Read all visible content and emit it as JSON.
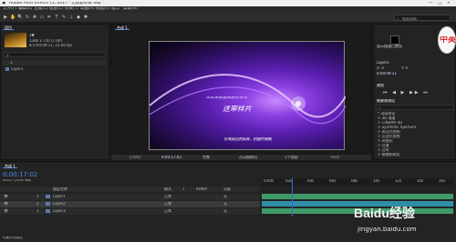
{
  "window": {
    "title": "Adobe After Effects CC 2017 - 无标题项目.aep *",
    "controls": [
      "—",
      "□",
      "✕"
    ]
  },
  "menu": [
    "文件(F)",
    "编辑(E)",
    "合成(C)",
    "图层(L)",
    "效果(T)",
    "动画(A)",
    "视图(V)",
    "窗口",
    "帮助(H)"
  ],
  "toolbar": {
    "tools": [
      "▶",
      "✋",
      "🔍",
      "↻",
      "✥",
      "▭",
      "✒",
      "T",
      "✎",
      "⊥",
      "◆",
      "✱"
    ],
    "workspace_search": "搜索帮助"
  },
  "project": {
    "tab": "项目",
    "item_name": "1▼",
    "item_info_1": "1280 x 720 (1.00)",
    "item_info_2": "Δ 0:00:09:11, 25.00 fps",
    "search_placeholder": "ρ",
    "rows": [
      "1",
      "Layer1"
    ]
  },
  "viewer": {
    "tab": "合成 1",
    "overlay_line1": "风吹来那些美丽的诗句",
    "overlay_line2": "送审样片",
    "caption": "好哦莫自然搞来，拍摄传模糊",
    "footer": [
      "(75%)",
      "0:00:17:02",
      "完整",
      "活动摄像机",
      "1个视图",
      "+0.0"
    ]
  },
  "right_panel": {
    "header_top": "显示加速已禁用",
    "layer_label": "Layer1",
    "info_lines": [
      "X: 0",
      "Y: 0"
    ],
    "time_code": "0:00:09:11",
    "preview_label": "预览",
    "effects_label": "效果和预设",
    "effects_list": [
      "* 动画预设",
      "> 3D 通道",
      "> CINEMA 4D",
      "> Synthetic Aperture",
      "> 表达式控制",
      "> 沉浸式视频",
      "> 风格化",
      "> 过渡",
      "> 过时",
      "> 模糊和锐化"
    ],
    "logo": "中英"
  },
  "timeline": {
    "tab": "合成 1",
    "current_time": "0:00:17:02",
    "time_sub": "00427 (25.00 fps)",
    "columns": [
      "图层名称",
      "模式",
      "T",
      "TrkMat",
      "父级"
    ],
    "layers": [
      {
        "num": "1",
        "name": "Layer1",
        "mode": "正常",
        "parent": "无"
      },
      {
        "num": "2",
        "name": "Layer2",
        "mode": "正常",
        "parent": "无"
      },
      {
        "num": "3",
        "name": "Layer3",
        "mode": "正常",
        "parent": "无"
      }
    ],
    "ruler": [
      "0:00s",
      "02s",
      "04s",
      "06s",
      "08s",
      "10s",
      "12s",
      "14s",
      "16s"
    ],
    "footer_label": "切换开关/模式"
  },
  "watermark": {
    "brand": "Baidu经验",
    "url": "jingyan.baidu.com"
  },
  "colors": {
    "accent": "#4a7fd6",
    "track_green": "#3f9a6a",
    "track_cyan": "#2f8fa8",
    "playhead": "#2d6cdf",
    "logo_red": "#d92020"
  }
}
